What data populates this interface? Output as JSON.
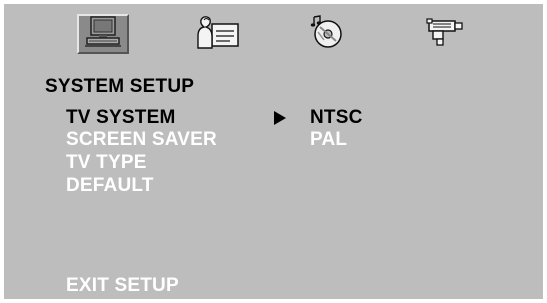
{
  "tabs": [
    {
      "icon": "monitor-icon",
      "name": "system"
    },
    {
      "icon": "language-icon",
      "name": "language"
    },
    {
      "icon": "audio-disc-icon",
      "name": "audio"
    },
    {
      "icon": "video-camera-icon",
      "name": "video"
    }
  ],
  "menu": {
    "title": "SYSTEM SETUP",
    "items": [
      {
        "label": "TV SYSTEM",
        "selected": true
      },
      {
        "label": "SCREEN SAVER",
        "selected": false
      },
      {
        "label": "TV TYPE",
        "selected": false
      },
      {
        "label": "DEFAULT",
        "selected": false
      }
    ],
    "exit_label": "EXIT SETUP"
  },
  "options": {
    "items": [
      {
        "label": "NTSC",
        "selected": true
      },
      {
        "label": "PAL",
        "selected": false
      }
    ]
  },
  "colors": {
    "panel": "#bdbdbd",
    "active_text": "#000000",
    "inactive_text": "#ffffff"
  }
}
